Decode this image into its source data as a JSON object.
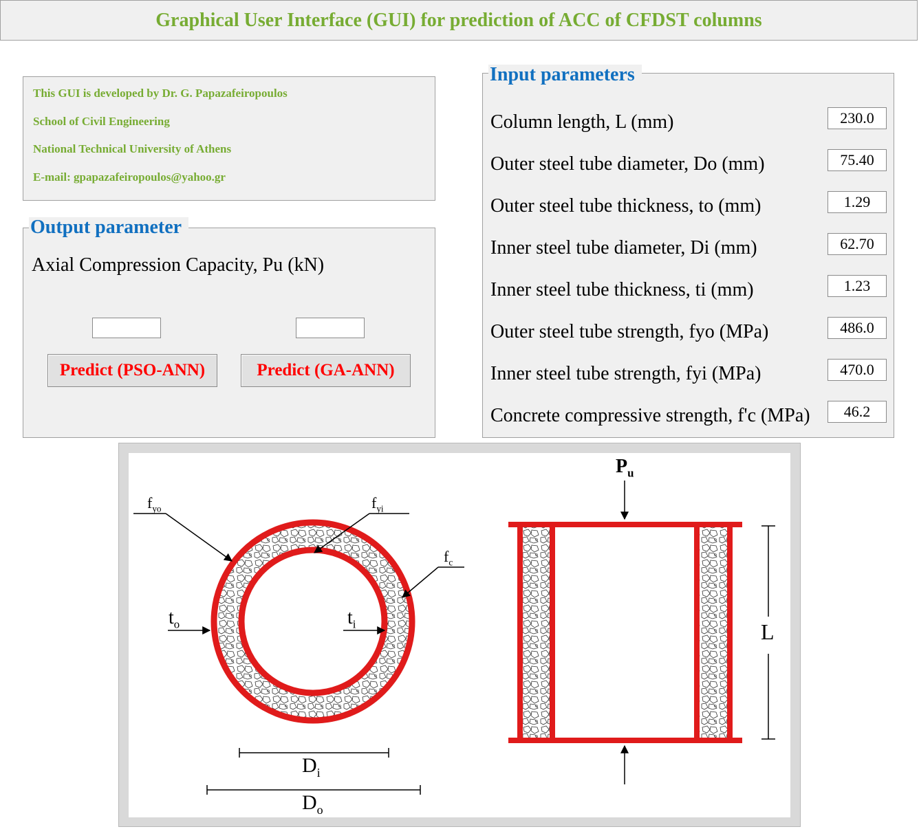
{
  "header": {
    "title": "Graphical User Interface (GUI) for prediction of ACC of CFDST columns"
  },
  "info": {
    "line1": "This GUI is developed by Dr. G. Papazafeiropoulos",
    "line2": "School of Civil Engineering",
    "line3": "National Technical University of Athens",
    "line4": "E-mail: gpapazafeiropoulos@yahoo.gr"
  },
  "output": {
    "title": "Output parameter",
    "label": "Axial Compression Capacity, Pu (kN)",
    "pso_value": "",
    "ga_value": "",
    "pso_button": "Predict (PSO-ANN)",
    "ga_button": "Predict (GA-ANN)"
  },
  "input": {
    "title": "Input parameters",
    "rows": [
      {
        "label": "Column length, L (mm)",
        "value": "230.0"
      },
      {
        "label": "Outer steel tube diameter, Do (mm)",
        "value": "75.40"
      },
      {
        "label": "Outer steel tube thickness, to (mm)",
        "value": "1.29"
      },
      {
        "label": "Inner steel tube diameter, Di (mm)",
        "value": "62.70"
      },
      {
        "label": "Inner steel tube thickness, ti (mm)",
        "value": "1.23"
      },
      {
        "label": "Outer steel tube strength, fyo (MPa)",
        "value": "486.0"
      },
      {
        "label": "Inner steel tube strength, fyi (MPa)",
        "value": "470.0"
      },
      {
        "label": "Concrete compressive strength, f'c (MPa)",
        "value": "46.2"
      }
    ]
  },
  "figure": {
    "fyo_main": "f",
    "fyo_sub": "yo",
    "fyi_main": "f",
    "fyi_sub": "yi",
    "fc_main": "f",
    "fc_sub": "c",
    "to_main": "t",
    "to_sub": "o",
    "ti_main": "t",
    "ti_sub": "i",
    "di_main": "D",
    "di_sub": "i",
    "do_main": "D",
    "do_sub": "o",
    "pu_main": "P",
    "pu_sub": "u",
    "length": "L",
    "steel_color": "#e01b1b"
  }
}
